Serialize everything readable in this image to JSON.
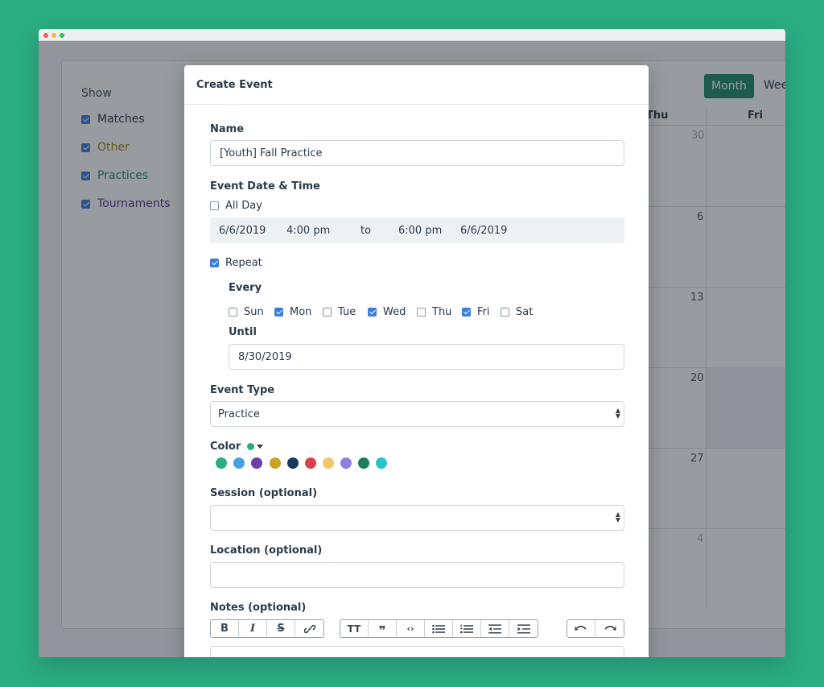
{
  "calendar": {
    "show_label": "Show",
    "filters": [
      {
        "label": "Matches",
        "color": "#2b3a4a",
        "checked": true
      },
      {
        "label": "Other",
        "color": "#a7801b",
        "checked": true
      },
      {
        "label": "Practices",
        "color": "#1f8a66",
        "checked": true
      },
      {
        "label": "Tournaments",
        "color": "#5b2d8f",
        "checked": true
      }
    ],
    "view_month": "Month",
    "view_week": "Wee",
    "col_thu": "Thu",
    "col_fri": "Fri",
    "dates": [
      "30",
      "6",
      "13",
      "20",
      "27",
      "4"
    ]
  },
  "modal": {
    "title": "Create Event",
    "name_label": "Name",
    "name_value": "[Youth] Fall Practice",
    "datetime_label": "Event Date & Time",
    "all_day_label": "All Day",
    "all_day_checked": false,
    "start_date": "6/6/2019",
    "start_time": "4:00 pm",
    "to_label": "to",
    "end_time": "6:00 pm",
    "end_date": "6/6/2019",
    "repeat_label": "Repeat",
    "repeat_checked": true,
    "every_label": "Every",
    "days": [
      {
        "label": "Sun",
        "checked": false
      },
      {
        "label": "Mon",
        "checked": true
      },
      {
        "label": "Tue",
        "checked": false
      },
      {
        "label": "Wed",
        "checked": true
      },
      {
        "label": "Thu",
        "checked": false
      },
      {
        "label": "Fri",
        "checked": true
      },
      {
        "label": "Sat",
        "checked": false
      }
    ],
    "until_label": "Until",
    "until_value": "8/30/2019",
    "event_type_label": "Event Type",
    "event_type_value": "Practice",
    "color_label": "Color",
    "selected_color": "#2bad82",
    "colors": [
      "#2bad82",
      "#4a9fdc",
      "#6b3fa8",
      "#c9a227",
      "#163a5f",
      "#d9444a",
      "#f7c56b",
      "#8f7de0",
      "#1f7a5e",
      "#2ac3c9"
    ],
    "session_label": "Session (optional)",
    "session_value": "",
    "location_label": "Location (optional)",
    "location_value": "",
    "notes_label": "Notes (optional)",
    "toolbar": [
      "bold",
      "italic",
      "strikethrough",
      "link",
      "heading",
      "quote",
      "code",
      "bullet-list",
      "numbered-list",
      "outdent",
      "indent",
      "undo",
      "redo"
    ]
  }
}
